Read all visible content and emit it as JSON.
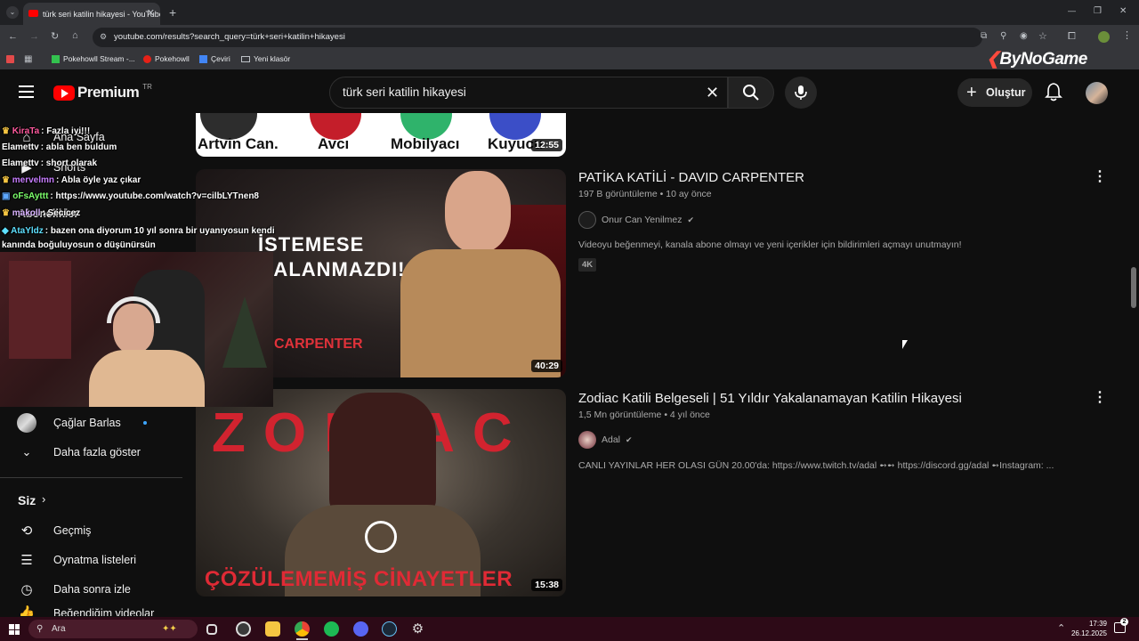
{
  "browser": {
    "tab_title": "türk seri katilin hikayesi - YouTube",
    "tab_close": "✕",
    "new_tab": "+",
    "url": "youtube.com/results?search_query=türk+seri+katilin+hikayesi",
    "window_controls": [
      "—",
      "❐",
      "✕"
    ],
    "bookmarks": [
      {
        "label": "Pokehowll Stream -...",
        "color": "#33c24f"
      },
      {
        "label": "Pokehowll",
        "color": "#e62117"
      },
      {
        "label": "Çeviri",
        "color": "#4285f4"
      },
      {
        "label": "Yeni klasör",
        "color": "#bdc1c6"
      }
    ]
  },
  "watermark": {
    "text": "ByNoGame"
  },
  "youtube": {
    "logo_text": "Premium",
    "logo_region": "TR",
    "search_value": "türk seri katilin hikayesi",
    "create_label": "Oluştur"
  },
  "sidebar": {
    "home_label": "Ana Sayfa",
    "shorts_label": "Shorts",
    "subscriptions_label": "Abonelikler",
    "channel_item": "Çağlar Barlas",
    "show_more": "Daha fazla göster",
    "you_section": "Siz",
    "history": "Geçmiş",
    "playlists": "Oynatma listeleri",
    "watch_later": "Daha sonra izle",
    "liked": "Beğendiğim videolar"
  },
  "chat": [
    {
      "user": "KiraTa",
      "user_color": "#ff5a9e",
      "msg": "Fazla iyi!!!"
    },
    {
      "user": "Elamettv",
      "user_color": "#ffffff",
      "msg": "abla ben buldum"
    },
    {
      "user": "Elamettv",
      "user_color": "#ffffff",
      "msg": "short olarak"
    },
    {
      "user": "mervelmn",
      "user_color": "#c77dff",
      "msg": "Abla öyle yaz çıkar"
    },
    {
      "user": "oFsAyttt",
      "user_color": "#7cff6b",
      "msg": "https://www.youtube.com/watch?v=cilbLYTnen8"
    },
    {
      "user": "makoll",
      "user_color": "#d9b3ff",
      "msg": "Secicez"
    },
    {
      "user": "AtaYldz",
      "user_color": "#5ee0ff",
      "msg": "bazen ona diyorum 10 yıl sonra bir uyanıyosun kendi kanında boğuluyosun o düşünürsün"
    }
  ],
  "videos": [
    {
      "thumb_labels": [
        "Artvin Can.",
        "Avcı",
        "Mobilyacı",
        "Kuyucu"
      ],
      "duration": "12:55"
    },
    {
      "title": "PATİKA KATİLİ - DAVID CARPENTER",
      "views": "197 B görüntüleme",
      "age": "10 ay önce",
      "channel": "Onur Can Yenilmez",
      "description": "Videoyu beğenmeyi, kanala abone olmayı ve yeni içerikler için bildirimleri açmayı unutmayın!",
      "badge": "4K",
      "thumb_text1": "İSTEMESE",
      "thumb_text2": "YAKALANMAZDI!",
      "thumb_text3": "CARPENTER",
      "duration": "40:29"
    },
    {
      "title": "Zodiac Katili Belgeseli | 51 Yıldır Yakalanamayan Katilin Hikayesi",
      "views": "1,5 Mn görüntüleme",
      "age": "4 yıl önce",
      "channel": "Adal",
      "description": "CANLI YAYINLAR HER OLASI GÜN 20.00'da: https://www.twitch.tv/adal ➻➻ https://discord.gg/adal ➻Instagram: ...",
      "thumb_text1": "ZODIAC",
      "thumb_text2": "ÇÖZÜLEMEMİŞ CİNAYETLER",
      "duration": "15:38"
    }
  ],
  "taskbar": {
    "search_label": "Ara",
    "time": "17:39",
    "date": "26.12.2025",
    "notif_count": "2"
  }
}
